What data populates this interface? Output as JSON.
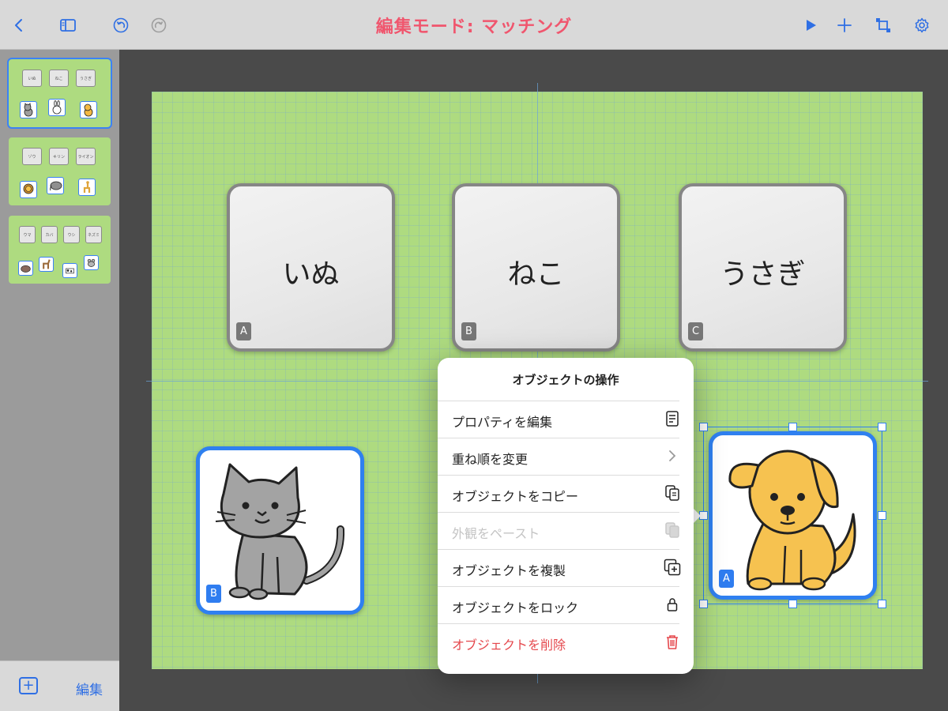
{
  "app": {
    "title": "編集モード: マッチング",
    "accent_color": "#f0566e",
    "link_color": "#2f6fe4"
  },
  "toolbar": {
    "left_icons": [
      "chevron-left-icon",
      "sidebar-toggle-icon",
      "undo-icon",
      "redo-icon"
    ],
    "right_icons": [
      "play-icon",
      "plus-icon",
      "crop-icon",
      "gear-icon"
    ]
  },
  "sidebar": {
    "slides": [
      {
        "cards": [
          "いぬ",
          "ねこ",
          "うさぎ"
        ],
        "pictures": [
          "cat",
          "rabbit",
          "dog"
        ],
        "selected": true
      },
      {
        "cards": [
          "ゾウ",
          "キリン",
          "ライオン"
        ],
        "pictures": [
          "lion",
          "elephant",
          "giraffe"
        ],
        "selected": false
      },
      {
        "cards": [
          "ウマ",
          "カバ",
          "ウシ",
          "ネズミ"
        ],
        "pictures": [
          "hippo",
          "horse",
          "cow",
          "mouse"
        ],
        "selected": false
      }
    ],
    "edit_label": "編集"
  },
  "canvas": {
    "word_cards": [
      {
        "word": "いぬ",
        "badge": "A"
      },
      {
        "word": "ねこ",
        "badge": "B"
      },
      {
        "word": "うさぎ",
        "badge": "C"
      }
    ],
    "picture_cards": [
      {
        "picture": "cat",
        "badge": "B"
      },
      {
        "picture": "dog",
        "badge": "A",
        "selected": true
      }
    ]
  },
  "popover": {
    "title": "オブジェクトの操作",
    "items": [
      {
        "label": "プロパティを編集",
        "icon": "document-icon",
        "state": "normal"
      },
      {
        "label": "重ね順を変更",
        "icon": "chevron-right-icon",
        "state": "normal"
      },
      {
        "label": "オブジェクトをコピー",
        "icon": "copy-icon",
        "state": "normal"
      },
      {
        "label": "外観をペースト",
        "icon": "paste-icon",
        "state": "disabled"
      },
      {
        "label": "オブジェクトを複製",
        "icon": "duplicate-icon",
        "state": "normal"
      },
      {
        "label": "オブジェクトをロック",
        "icon": "lock-icon",
        "state": "normal"
      },
      {
        "label": "オブジェクトを削除",
        "icon": "trash-icon",
        "state": "danger"
      }
    ]
  }
}
